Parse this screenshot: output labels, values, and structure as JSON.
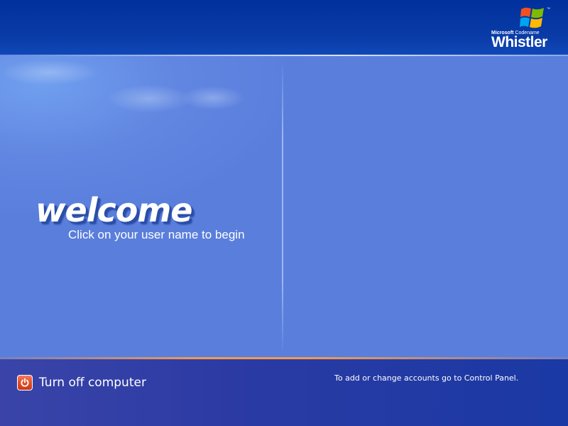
{
  "logo": {
    "brand": "Microsoft",
    "codename_label": "Codename",
    "product": "Whistler",
    "trademark": "™",
    "icon": "windows-flag-logo",
    "flag_colors": [
      "#f25022",
      "#7fba00",
      "#00a4ef",
      "#ffb900"
    ]
  },
  "welcome": {
    "title": "welcome",
    "subtitle": "Click on your user name to begin"
  },
  "footer": {
    "turn_off_label": "Turn off computer",
    "turn_off_icon": "power-icon",
    "accounts_hint": "To add or change accounts go to Control Panel."
  },
  "colors": {
    "top_bar": "#00309c",
    "main_background": "#5a7edc",
    "bottom_bar": "#2a3aa4",
    "accent_line": "#f39a4c",
    "power_button": "#e0502c"
  }
}
